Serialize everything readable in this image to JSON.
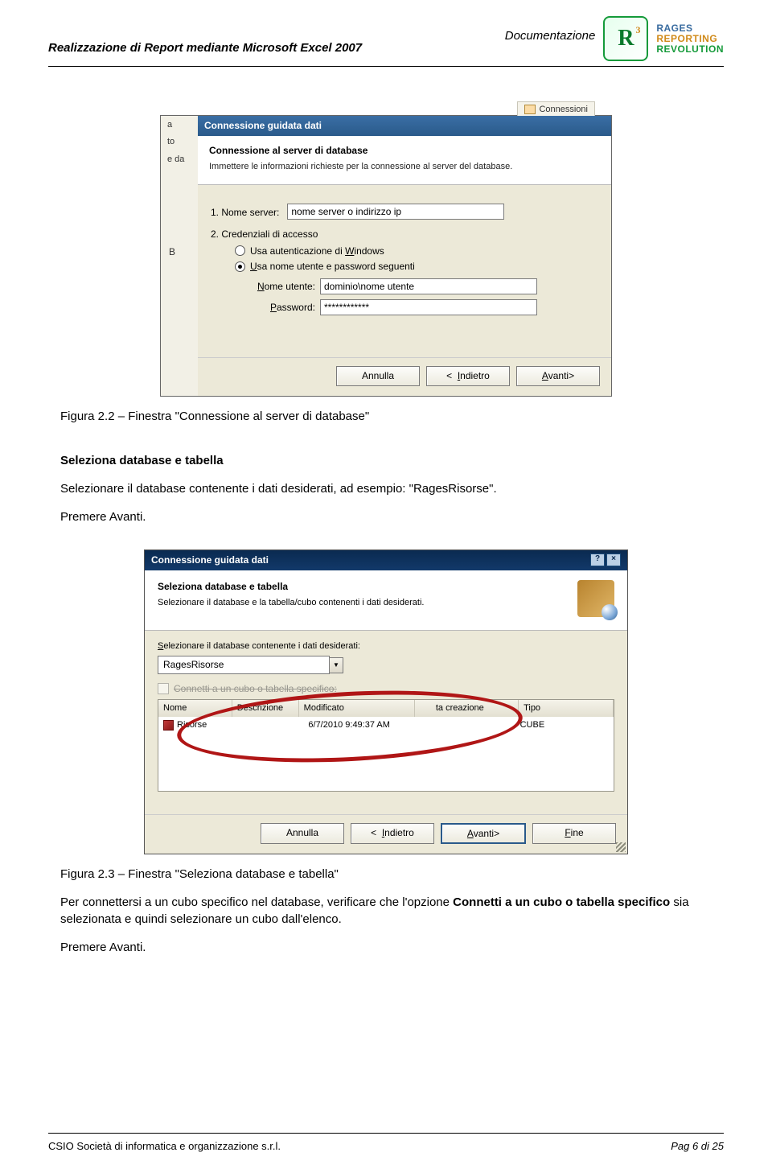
{
  "header": {
    "title_left": "Realizzazione di Report mediante Microsoft Excel 2007",
    "title_right": "Documentazione",
    "logo": {
      "line1": "RAGES",
      "line2": "REPORTING",
      "line3": "REVOLUTION"
    }
  },
  "dialog1": {
    "toolbar_conn": "Connessioni",
    "bg_a": "a",
    "bg_to": "to",
    "bg_dat": "e da",
    "bg_B": "B",
    "titlebar": "Connessione guidata dati",
    "heading": "Connessione al server di database",
    "subtext": "Immettere le informazioni richieste per la connessione al server del database.",
    "step1": "1. Nome server:",
    "server_value": "nome server o indirizzo ip",
    "step2": "2. Credenziali di accesso",
    "radio_win": "Usa autenticazione di Windows",
    "radio_user": "Usa nome utente e password seguenti",
    "label_user": "Nome utente:",
    "user_value": "dominio\\nome utente",
    "label_pass": "Password:",
    "pass_value": "************",
    "btn_cancel": "Annulla",
    "btn_back": "<  Indietro",
    "btn_next": "Avanti>"
  },
  "caption1": "Figura 2.2 – Finestra \"Connessione al server di database\"",
  "section_heading": "Seleziona database e tabella",
  "para1": "Selezionare il database contenente i dati desiderati, ad esempio: \"RagesRisorse\".",
  "para2": "Premere Avanti.",
  "dialog2": {
    "titlebar": "Connessione guidata dati",
    "heading": "Seleziona database e tabella",
    "subtext": "Selezionare il database e la tabella/cubo contenenti i dati desiderati.",
    "select_label": "Selezionare il database contenente i dati desiderati:",
    "combo_value": "RagesRisorse",
    "checkbox_label": "Connetti a un cubo o tabella specifico:",
    "columns": {
      "nome": "Nome",
      "desc": "Descrizione",
      "mod": "Modificato",
      "crea": "Data creazione",
      "tipo": "Tipo"
    },
    "row": {
      "nome": "Risorse",
      "desc": "",
      "mod": "6/7/2010 9:49:37 AM",
      "crea": "",
      "tipo": "CUBE"
    },
    "btn_cancel": "Annulla",
    "btn_back": "<  Indietro",
    "btn_next": "Avanti>",
    "btn_end": "Fine"
  },
  "caption2": "Figura 2.3 – Finestra \"Seleziona database e tabella\"",
  "para3_a": "Per connettersi a un cubo specifico nel database, verificare che l'opzione ",
  "para3_bold": "Connetti a un cubo o tabella specifico",
  "para3_b": " sia selezionata e quindi selezionare un cubo dall'elenco.",
  "para4": "Premere Avanti.",
  "footer": {
    "left": "CSIO   Società di informatica e organizzazione s.r.l.",
    "right": "Pag 6 di 25"
  }
}
